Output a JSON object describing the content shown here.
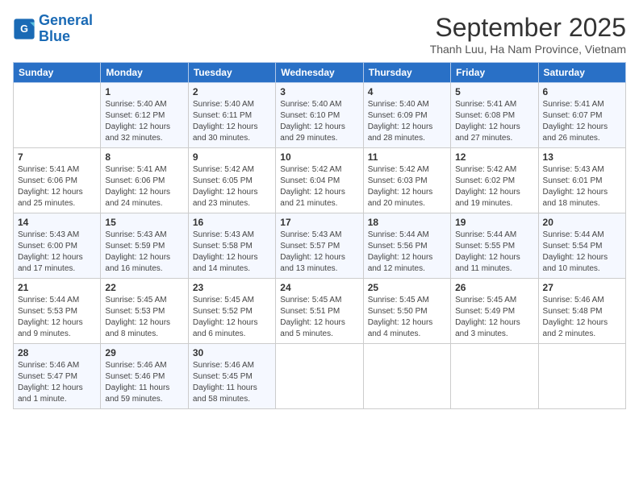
{
  "header": {
    "logo_line1": "General",
    "logo_line2": "Blue",
    "month": "September 2025",
    "location": "Thanh Luu, Ha Nam Province, Vietnam"
  },
  "weekdays": [
    "Sunday",
    "Monday",
    "Tuesday",
    "Wednesday",
    "Thursday",
    "Friday",
    "Saturday"
  ],
  "weeks": [
    [
      {
        "day": "",
        "info": ""
      },
      {
        "day": "1",
        "info": "Sunrise: 5:40 AM\nSunset: 6:12 PM\nDaylight: 12 hours\nand 32 minutes."
      },
      {
        "day": "2",
        "info": "Sunrise: 5:40 AM\nSunset: 6:11 PM\nDaylight: 12 hours\nand 30 minutes."
      },
      {
        "day": "3",
        "info": "Sunrise: 5:40 AM\nSunset: 6:10 PM\nDaylight: 12 hours\nand 29 minutes."
      },
      {
        "day": "4",
        "info": "Sunrise: 5:40 AM\nSunset: 6:09 PM\nDaylight: 12 hours\nand 28 minutes."
      },
      {
        "day": "5",
        "info": "Sunrise: 5:41 AM\nSunset: 6:08 PM\nDaylight: 12 hours\nand 27 minutes."
      },
      {
        "day": "6",
        "info": "Sunrise: 5:41 AM\nSunset: 6:07 PM\nDaylight: 12 hours\nand 26 minutes."
      }
    ],
    [
      {
        "day": "7",
        "info": "Sunrise: 5:41 AM\nSunset: 6:06 PM\nDaylight: 12 hours\nand 25 minutes."
      },
      {
        "day": "8",
        "info": "Sunrise: 5:41 AM\nSunset: 6:06 PM\nDaylight: 12 hours\nand 24 minutes."
      },
      {
        "day": "9",
        "info": "Sunrise: 5:42 AM\nSunset: 6:05 PM\nDaylight: 12 hours\nand 23 minutes."
      },
      {
        "day": "10",
        "info": "Sunrise: 5:42 AM\nSunset: 6:04 PM\nDaylight: 12 hours\nand 21 minutes."
      },
      {
        "day": "11",
        "info": "Sunrise: 5:42 AM\nSunset: 6:03 PM\nDaylight: 12 hours\nand 20 minutes."
      },
      {
        "day": "12",
        "info": "Sunrise: 5:42 AM\nSunset: 6:02 PM\nDaylight: 12 hours\nand 19 minutes."
      },
      {
        "day": "13",
        "info": "Sunrise: 5:43 AM\nSunset: 6:01 PM\nDaylight: 12 hours\nand 18 minutes."
      }
    ],
    [
      {
        "day": "14",
        "info": "Sunrise: 5:43 AM\nSunset: 6:00 PM\nDaylight: 12 hours\nand 17 minutes."
      },
      {
        "day": "15",
        "info": "Sunrise: 5:43 AM\nSunset: 5:59 PM\nDaylight: 12 hours\nand 16 minutes."
      },
      {
        "day": "16",
        "info": "Sunrise: 5:43 AM\nSunset: 5:58 PM\nDaylight: 12 hours\nand 14 minutes."
      },
      {
        "day": "17",
        "info": "Sunrise: 5:43 AM\nSunset: 5:57 PM\nDaylight: 12 hours\nand 13 minutes."
      },
      {
        "day": "18",
        "info": "Sunrise: 5:44 AM\nSunset: 5:56 PM\nDaylight: 12 hours\nand 12 minutes."
      },
      {
        "day": "19",
        "info": "Sunrise: 5:44 AM\nSunset: 5:55 PM\nDaylight: 12 hours\nand 11 minutes."
      },
      {
        "day": "20",
        "info": "Sunrise: 5:44 AM\nSunset: 5:54 PM\nDaylight: 12 hours\nand 10 minutes."
      }
    ],
    [
      {
        "day": "21",
        "info": "Sunrise: 5:44 AM\nSunset: 5:53 PM\nDaylight: 12 hours\nand 9 minutes."
      },
      {
        "day": "22",
        "info": "Sunrise: 5:45 AM\nSunset: 5:53 PM\nDaylight: 12 hours\nand 8 minutes."
      },
      {
        "day": "23",
        "info": "Sunrise: 5:45 AM\nSunset: 5:52 PM\nDaylight: 12 hours\nand 6 minutes."
      },
      {
        "day": "24",
        "info": "Sunrise: 5:45 AM\nSunset: 5:51 PM\nDaylight: 12 hours\nand 5 minutes."
      },
      {
        "day": "25",
        "info": "Sunrise: 5:45 AM\nSunset: 5:50 PM\nDaylight: 12 hours\nand 4 minutes."
      },
      {
        "day": "26",
        "info": "Sunrise: 5:45 AM\nSunset: 5:49 PM\nDaylight: 12 hours\nand 3 minutes."
      },
      {
        "day": "27",
        "info": "Sunrise: 5:46 AM\nSunset: 5:48 PM\nDaylight: 12 hours\nand 2 minutes."
      }
    ],
    [
      {
        "day": "28",
        "info": "Sunrise: 5:46 AM\nSunset: 5:47 PM\nDaylight: 12 hours\nand 1 minute."
      },
      {
        "day": "29",
        "info": "Sunrise: 5:46 AM\nSunset: 5:46 PM\nDaylight: 11 hours\nand 59 minutes."
      },
      {
        "day": "30",
        "info": "Sunrise: 5:46 AM\nSunset: 5:45 PM\nDaylight: 11 hours\nand 58 minutes."
      },
      {
        "day": "",
        "info": ""
      },
      {
        "day": "",
        "info": ""
      },
      {
        "day": "",
        "info": ""
      },
      {
        "day": "",
        "info": ""
      }
    ]
  ]
}
